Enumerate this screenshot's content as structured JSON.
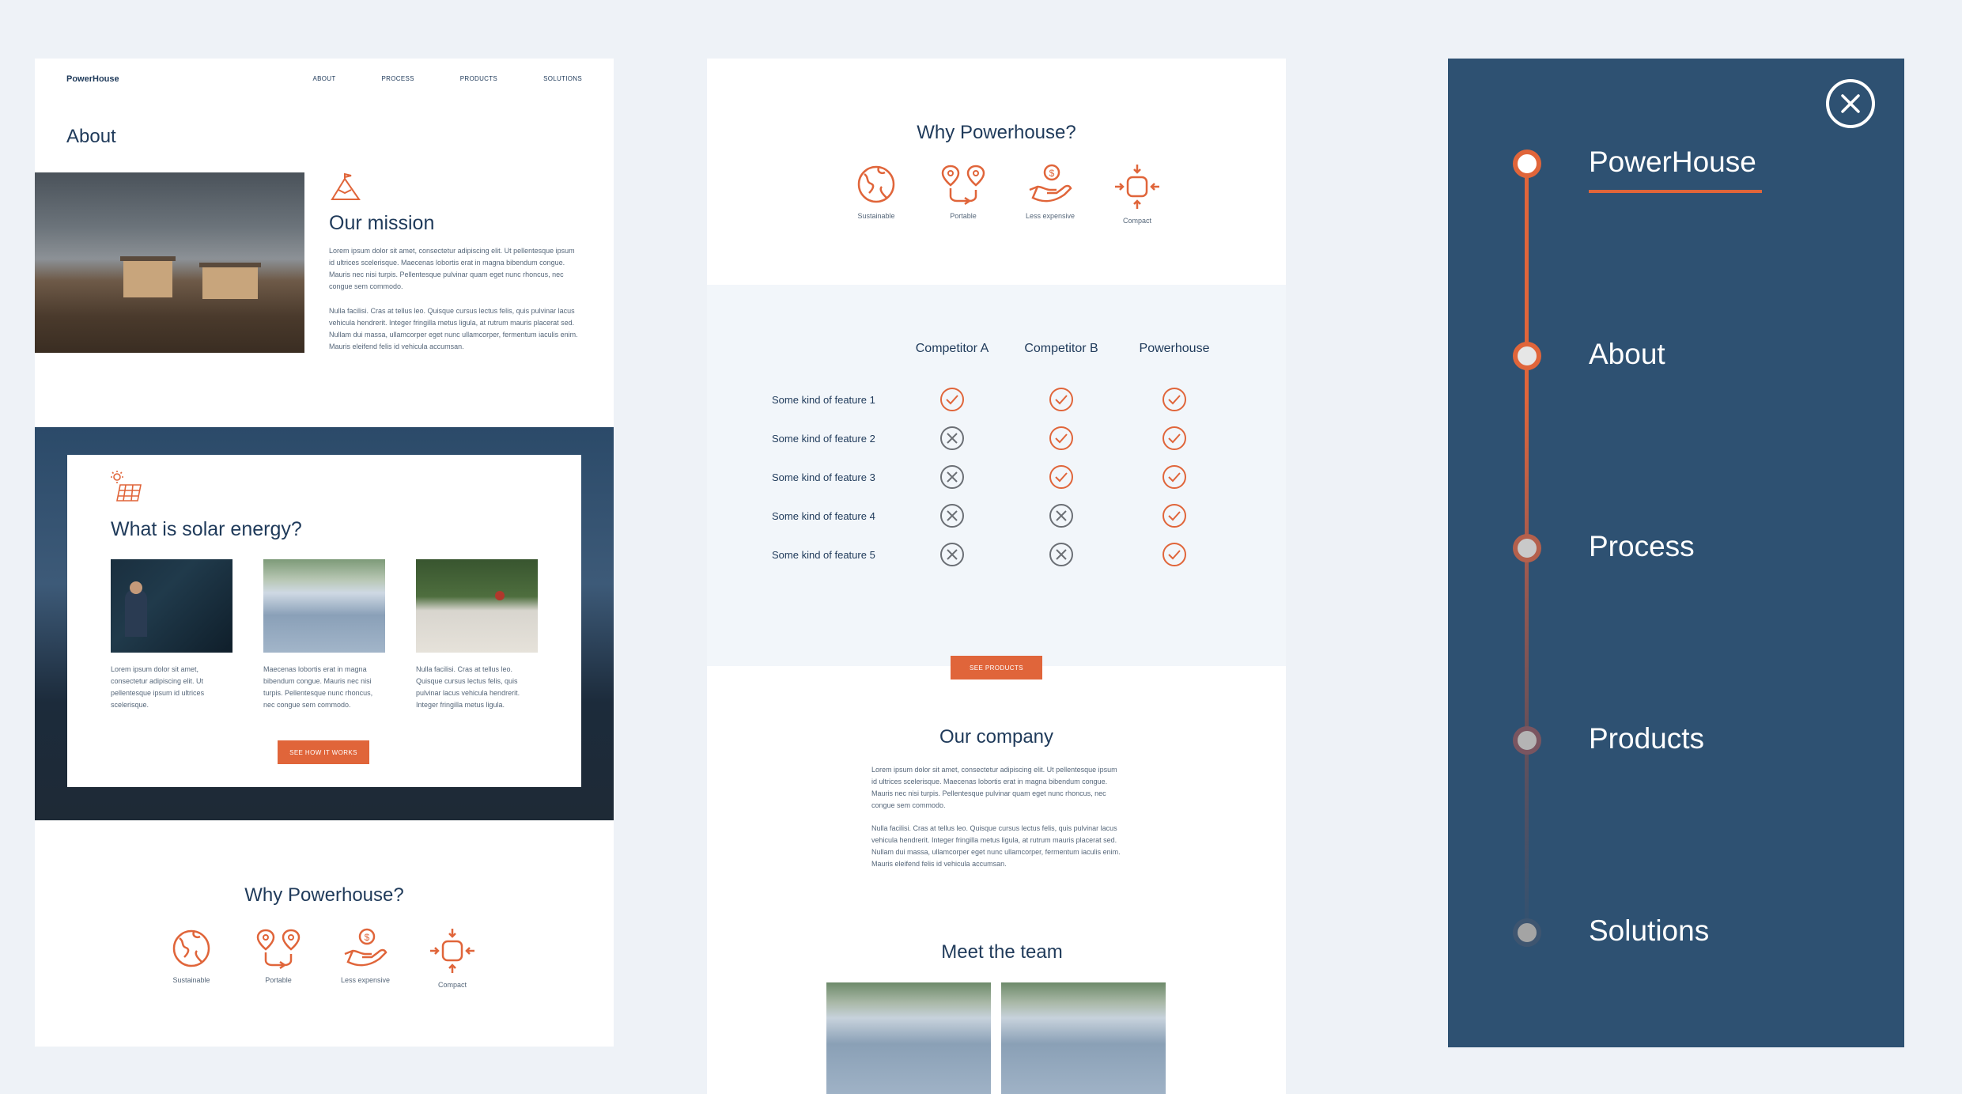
{
  "panel1": {
    "brand": "PowerHouse",
    "nav": [
      "ABOUT",
      "PROCESS",
      "PRODUCTS",
      "SOLUTIONS"
    ],
    "about_title": "About",
    "mission": {
      "title": "Our mission",
      "p1": "Lorem ipsum dolor sit amet, consectetur adipiscing elit. Ut pellentesque ipsum id ultrices scelerisque. Maecenas lobortis erat in magna bibendum congue. Mauris nec nisi turpis. Pellentesque pulvinar quam eget nunc rhoncus, nec congue sem commodo.",
      "p2": "Nulla facilisi. Cras at tellus leo. Quisque cursus lectus felis, quis pulvinar lacus vehicula hendrerit. Integer fringilla metus ligula, at rutrum mauris placerat sed. Nullam dui massa, ullamcorper eget nunc ullamcorper, fermentum iaculis enim. Mauris eleifend felis id vehicula accumsan."
    },
    "solar": {
      "title": "What is solar energy?",
      "captions": [
        "Lorem ipsum dolor sit amet, consectetur adipiscing elit. Ut pellentesque ipsum id ultrices scelerisque.",
        "Maecenas lobortis erat in magna bibendum congue. Mauris nec nisi turpis. Pellentesque nunc rhoncus, nec congue sem commodo.",
        "Nulla facilisi. Cras at tellus leo. Quisque cursus lectus felis, quis pulvinar lacus vehicula hendrerit. Integer fringilla metus ligula."
      ],
      "button": "SEE HOW IT WORKS"
    },
    "why_title": "Why Powerhouse?",
    "features": [
      {
        "label": "Sustainable",
        "icon": "globe-icon"
      },
      {
        "label": "Portable",
        "icon": "route-pins-icon"
      },
      {
        "label": "Less expensive",
        "icon": "hand-coin-icon"
      },
      {
        "label": "Compact",
        "icon": "compact-arrows-icon"
      }
    ]
  },
  "panel2": {
    "why_title": "Why Powerhouse?",
    "features": [
      {
        "label": "Sustainable",
        "icon": "globe-icon"
      },
      {
        "label": "Portable",
        "icon": "route-pins-icon"
      },
      {
        "label": "Less expensive",
        "icon": "hand-coin-icon"
      },
      {
        "label": "Compact",
        "icon": "compact-arrows-icon"
      }
    ],
    "comparison": {
      "columns": [
        "Competitor A",
        "Competitor B",
        "Powerhouse"
      ],
      "rows": [
        {
          "feature": "Some kind of feature 1",
          "values": [
            true,
            true,
            true
          ]
        },
        {
          "feature": "Some kind of feature 2",
          "values": [
            false,
            true,
            true
          ]
        },
        {
          "feature": "Some kind of feature 3",
          "values": [
            false,
            true,
            true
          ]
        },
        {
          "feature": "Some kind of feature 4",
          "values": [
            false,
            false,
            true
          ]
        },
        {
          "feature": "Some kind of feature 5",
          "values": [
            false,
            false,
            true
          ]
        }
      ],
      "button": "SEE PRODUCTS"
    },
    "company": {
      "title": "Our company",
      "p1": "Lorem ipsum dolor sit amet, consectetur adipiscing elit. Ut pellentesque ipsum id ultrices scelerisque. Maecenas lobortis erat in magna bibendum congue. Mauris nec nisi turpis. Pellentesque pulvinar quam eget nunc rhoncus, nec congue sem commodo.",
      "p2": "Nulla facilisi. Cras at tellus leo. Quisque cursus lectus felis, quis pulvinar lacus vehicula hendrerit. Integer fringilla metus ligula, at rutrum mauris placerat sed. Nullam dui massa, ullamcorper eget nunc ullamcorper, fermentum iaculis enim. Mauris eleifend felis id vehicula accumsan."
    },
    "team_title": "Meet the team"
  },
  "panel3": {
    "menu": [
      "PowerHouse",
      "About",
      "Process",
      "Products",
      "Solutions"
    ],
    "active_index": 0,
    "close_icon": "close-icon"
  },
  "colors": {
    "accent": "#e0653a",
    "navy": "#2e5172",
    "text": "#1f3a5a",
    "background": "#eef2f7"
  }
}
